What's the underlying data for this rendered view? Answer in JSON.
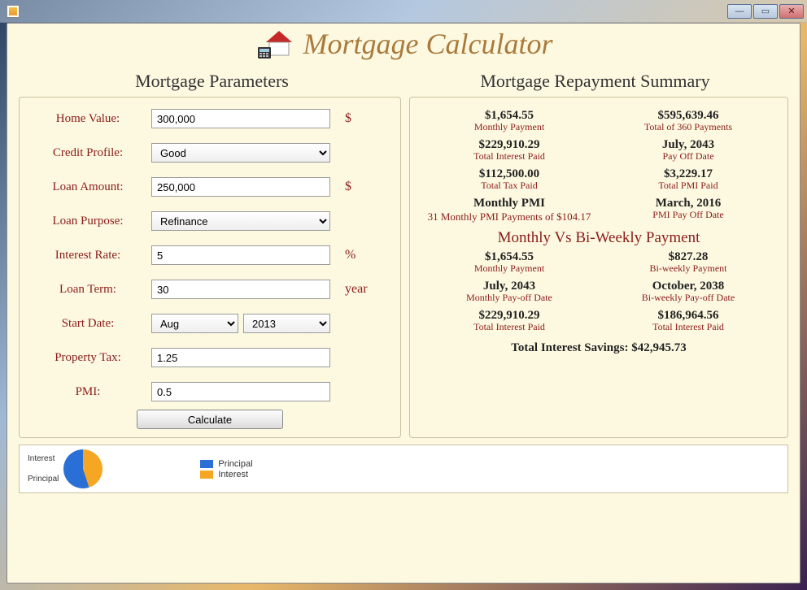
{
  "window": {
    "title": ""
  },
  "header": {
    "title": "Mortgage Calculator"
  },
  "sections": {
    "params_title": "Mortgage Parameters",
    "summary_title": "Mortgage Repayment Summary"
  },
  "form": {
    "home_value": {
      "label": "Home Value:",
      "value": "300,000",
      "unit": "$"
    },
    "credit_profile": {
      "label": "Credit Profile:",
      "value": "Good",
      "options": [
        "Good"
      ]
    },
    "loan_amount": {
      "label": "Loan Amount:",
      "value": "250,000",
      "unit": "$"
    },
    "loan_purpose": {
      "label": "Loan Purpose:",
      "value": "Refinance",
      "options": [
        "Refinance"
      ]
    },
    "interest_rate": {
      "label": "Interest Rate:",
      "value": "5",
      "unit": "%"
    },
    "loan_term": {
      "label": "Loan Term:",
      "value": "30",
      "unit": "year"
    },
    "start_date": {
      "label": "Start Date:",
      "month": "Aug",
      "year": "2013"
    },
    "property_tax": {
      "label": "Property Tax:",
      "value": "1.25"
    },
    "pmi": {
      "label": "PMI:",
      "value": "0.5"
    },
    "calc_button": "Calculate"
  },
  "summary": {
    "monthly_payment": {
      "value": "$1,654.55",
      "label": "Monthly Payment"
    },
    "total_payments": {
      "value": "$595,639.46",
      "label": "Total of 360 Payments"
    },
    "total_interest": {
      "value": "$229,910.29",
      "label": "Total Interest Paid"
    },
    "payoff_date": {
      "value": "July, 2043",
      "label": "Pay Off Date"
    },
    "total_tax": {
      "value": "$112,500.00",
      "label": "Total Tax Paid"
    },
    "total_pmi": {
      "value": "$3,229.17",
      "label": "Total PMI Paid"
    },
    "monthly_pmi_header": "Monthly PMI",
    "monthly_pmi_text": "31 Monthly PMI Payments of $104.17",
    "pmi_payoff": {
      "value": "March, 2016",
      "label": "PMI Pay Off Date"
    },
    "vs_header": "Monthly Vs Bi-Weekly Payment",
    "vs": {
      "monthly_payment": {
        "value": "$1,654.55",
        "label": "Monthly Payment"
      },
      "biweekly_payment": {
        "value": "$827.28",
        "label": "Bi-weekly Payment"
      },
      "monthly_payoff": {
        "value": "July, 2043",
        "label": "Monthly Pay-off Date"
      },
      "biweekly_payoff": {
        "value": "October, 2038",
        "label": "Bi-weekly Pay-off Date"
      },
      "monthly_interest": {
        "value": "$229,910.29",
        "label": "Total Interest Paid"
      },
      "biweekly_interest": {
        "value": "$186,964.56",
        "label": "Total Interest Paid"
      }
    },
    "total_savings": "Total Interest Savings: $42,945.73"
  },
  "chart_data": {
    "type": "pie",
    "title": "",
    "series": [
      {
        "name": "Interest",
        "value": 229910.29,
        "color": "#f5a623"
      },
      {
        "name": "Principal",
        "value": 250000.0,
        "color": "#2a6fd6"
      }
    ],
    "legend": [
      "Principal",
      "Interest"
    ],
    "pie_labels": [
      "Interest",
      "Principal"
    ]
  }
}
